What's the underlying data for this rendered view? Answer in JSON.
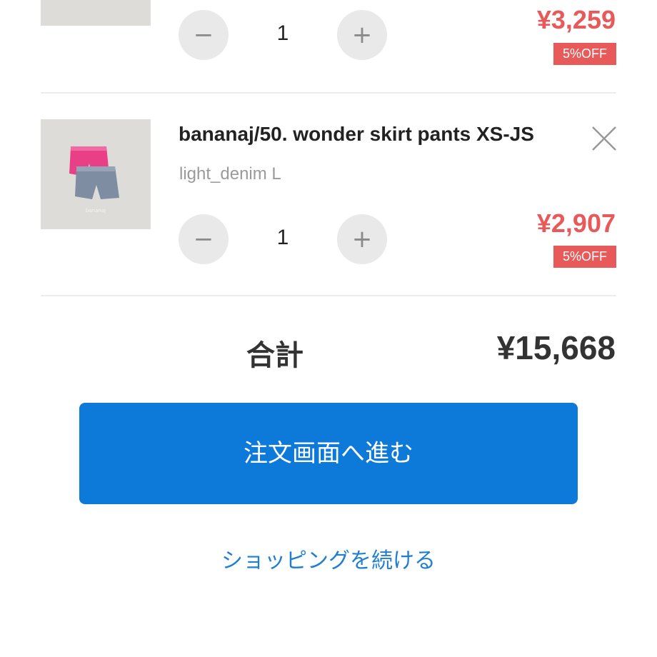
{
  "cart": {
    "items": [
      {
        "price": "¥3,259",
        "discount_badge": "5%OFF",
        "quantity": "1",
        "minus_label": "−",
        "plus_label": "+"
      },
      {
        "title": "bananaj/50. wonder skirt pants XS-JS",
        "variant": "light_denim L",
        "price": "¥2,907",
        "discount_badge": "5%OFF",
        "quantity": "1",
        "minus_label": "−",
        "plus_label": "+"
      }
    ],
    "total_label": "合計",
    "total_value": "¥15,668",
    "checkout_button": "注文画面へ進む",
    "continue_link": "ショッピングを続ける"
  },
  "colors": {
    "accent_blue": "#0d79d9",
    "price_red": "#e85a5a",
    "link_blue": "#1f7ed0"
  },
  "icons": {
    "remove": "close-icon",
    "decrease": "minus-icon",
    "increase": "plus-icon"
  }
}
